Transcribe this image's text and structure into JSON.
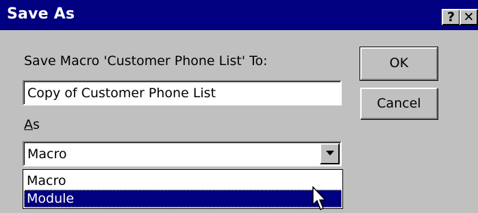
{
  "window": {
    "title": "Save As",
    "help_glyph": "?",
    "close_glyph": "✕"
  },
  "form": {
    "save_label": "Save Macro 'Customer Phone List' To:",
    "name_value": "Copy of Customer Phone List",
    "as_label_accel": "A",
    "as_label_rest": "s",
    "type_selected": "Macro",
    "type_options": [
      "Macro",
      "Module"
    ],
    "highlighted_option": "Module"
  },
  "buttons": {
    "ok": "OK",
    "cancel": "Cancel"
  },
  "colors": {
    "title_bar": "#000080",
    "face": "#c0c0c0",
    "highlight": "#000080"
  },
  "icons": {
    "dropdown": "chevron-down-icon",
    "cursor": "mouse-pointer-icon"
  }
}
